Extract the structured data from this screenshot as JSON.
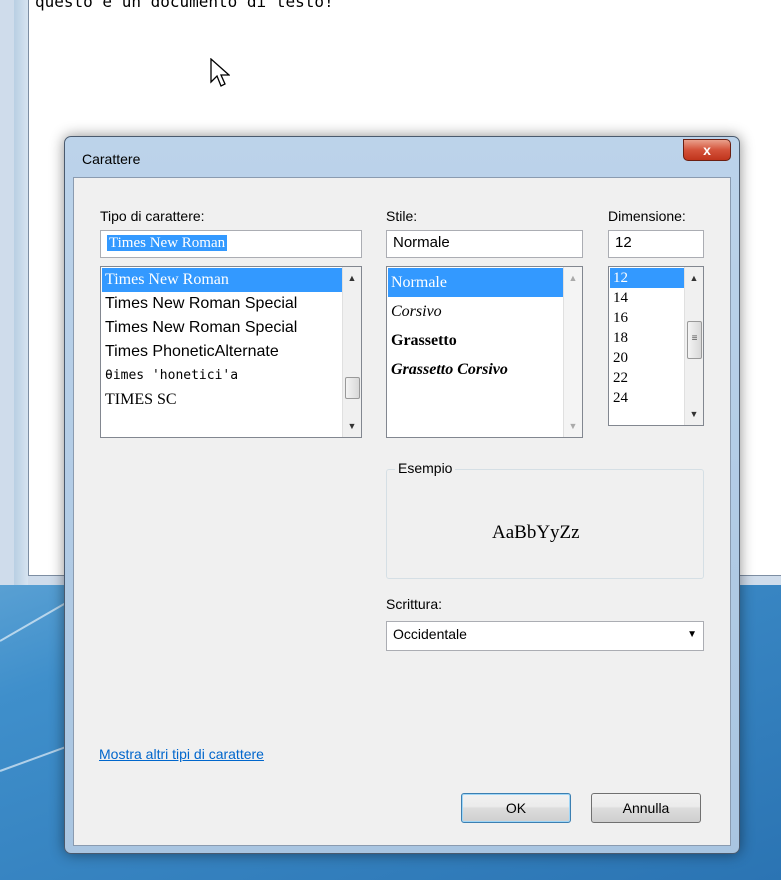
{
  "editor": {
    "text": "questo è un documento di testo!"
  },
  "dialog": {
    "title": "Carattere",
    "close_label": "x",
    "font_label": "Tipo di carattere:",
    "font_value": "Times New Roman",
    "font_list": [
      "Times New Roman",
      "Times New Roman Special",
      "Times New Roman Special",
      "Times PhoneticAlternate",
      "θimes 'honetici'a",
      "TIMES SC"
    ],
    "style_label": "Stile:",
    "style_value": "Normale",
    "style_list": [
      "Normale",
      "Corsivo",
      "Grassetto",
      "Grassetto Corsivo"
    ],
    "size_label": "Dimensione:",
    "size_value": "12",
    "size_list": [
      "12",
      "14",
      "16",
      "18",
      "20",
      "22",
      "24"
    ],
    "sample_label": "Esempio",
    "sample_text": "AaBbYyZz",
    "script_label": "Scrittura:",
    "script_value": "Occidentale",
    "more_fonts_link": "Mostra altri tipi di carattere",
    "ok_label": "OK",
    "cancel_label": "Annulla"
  },
  "colors": {
    "selection": "#3399ff",
    "link": "#0066cc",
    "close_button": "#c0341c"
  }
}
